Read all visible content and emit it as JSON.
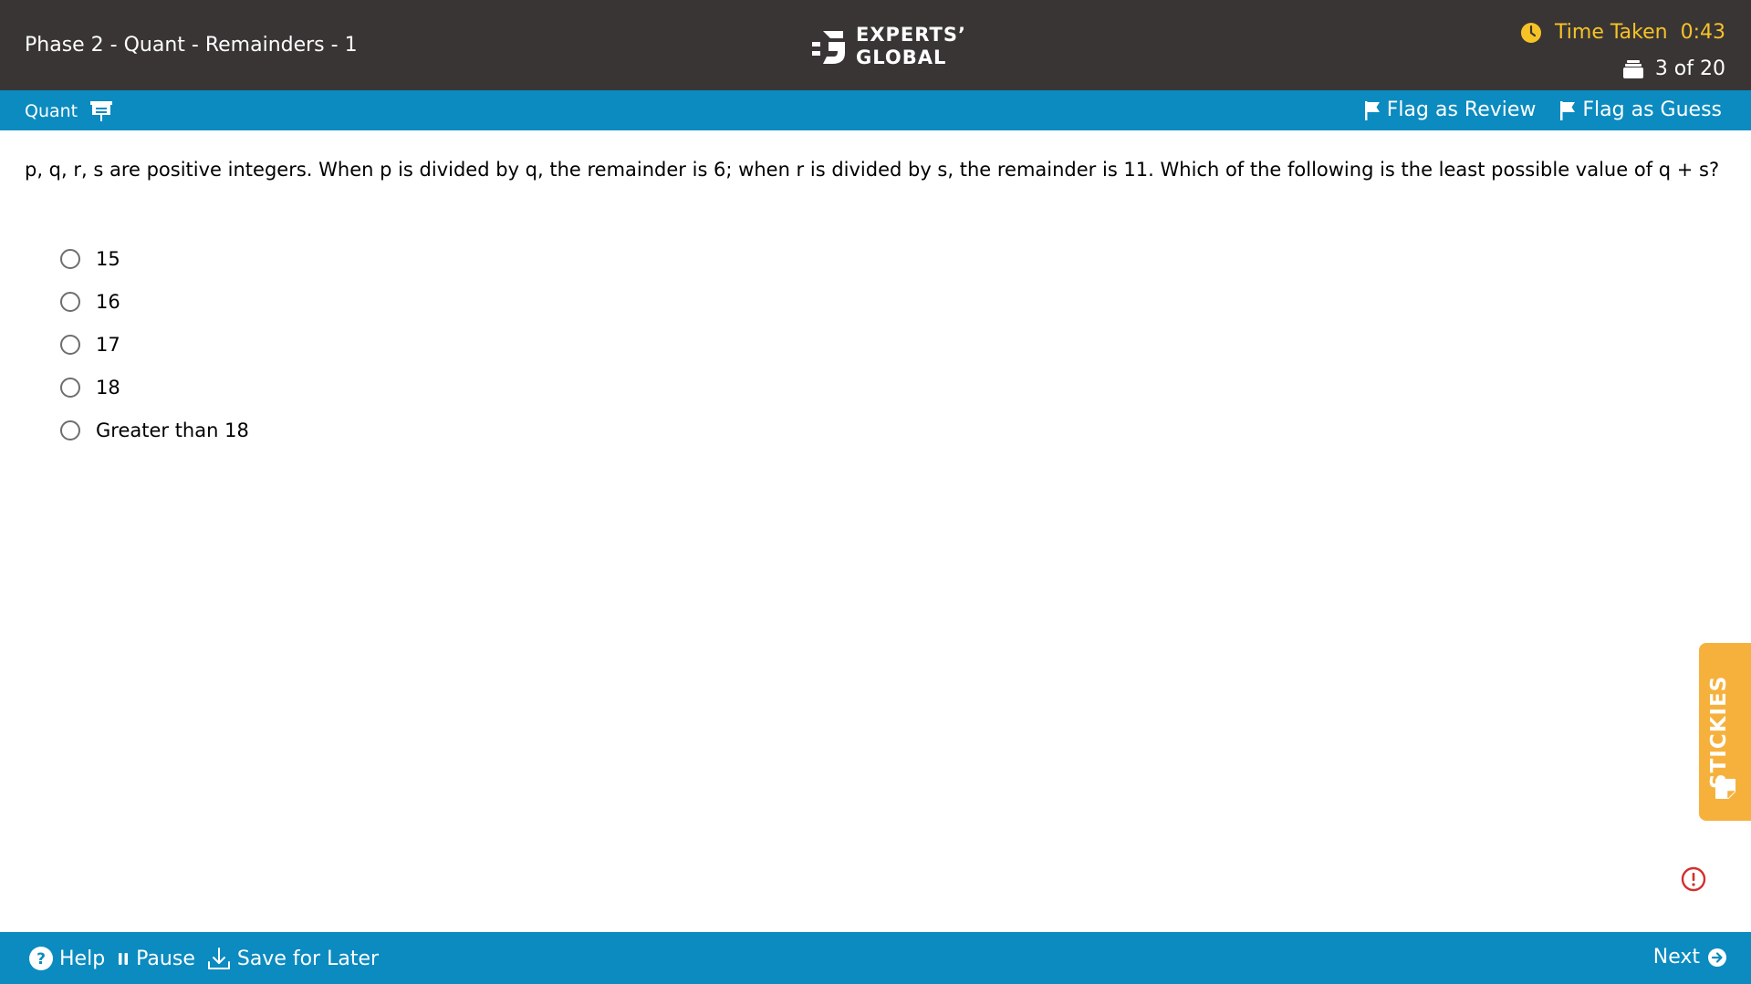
{
  "header": {
    "test_title": "Phase 2 - Quant - Remainders - 1",
    "logo": {
      "line1": "EXPERTS’",
      "line2": "GLOBAL"
    },
    "timer_label": "Time Taken",
    "timer_value": "0:43",
    "progress": "3 of 20",
    "icons": {
      "timer": "clock-icon",
      "progress": "question-stack-icon"
    }
  },
  "section_bar": {
    "section_name": "Quant",
    "section_icon": "presentation-board-icon",
    "flag_review": "Flag as Review",
    "flag_guess": "Flag as Guess"
  },
  "question": {
    "text": "p, q, r, s are positive integers. When p is divided by q, the remainder is 6; when r is divided by s, the remainder is 11. Which of the following is the least possible value of q + s?",
    "options": [
      "15",
      "16",
      "17",
      "18",
      "Greater than 18"
    ]
  },
  "stickies": {
    "label": "STICKIES"
  },
  "footer": {
    "help": "Help",
    "pause": "Pause",
    "save_for_later": "Save for Later",
    "next": "Next"
  },
  "colors": {
    "header_bg": "#3a3535",
    "bar_blue": "#0b8bc0",
    "timer_yellow": "#f6c327",
    "stickies_orange": "#f6b13d",
    "alert_red": "#d32f2f"
  }
}
